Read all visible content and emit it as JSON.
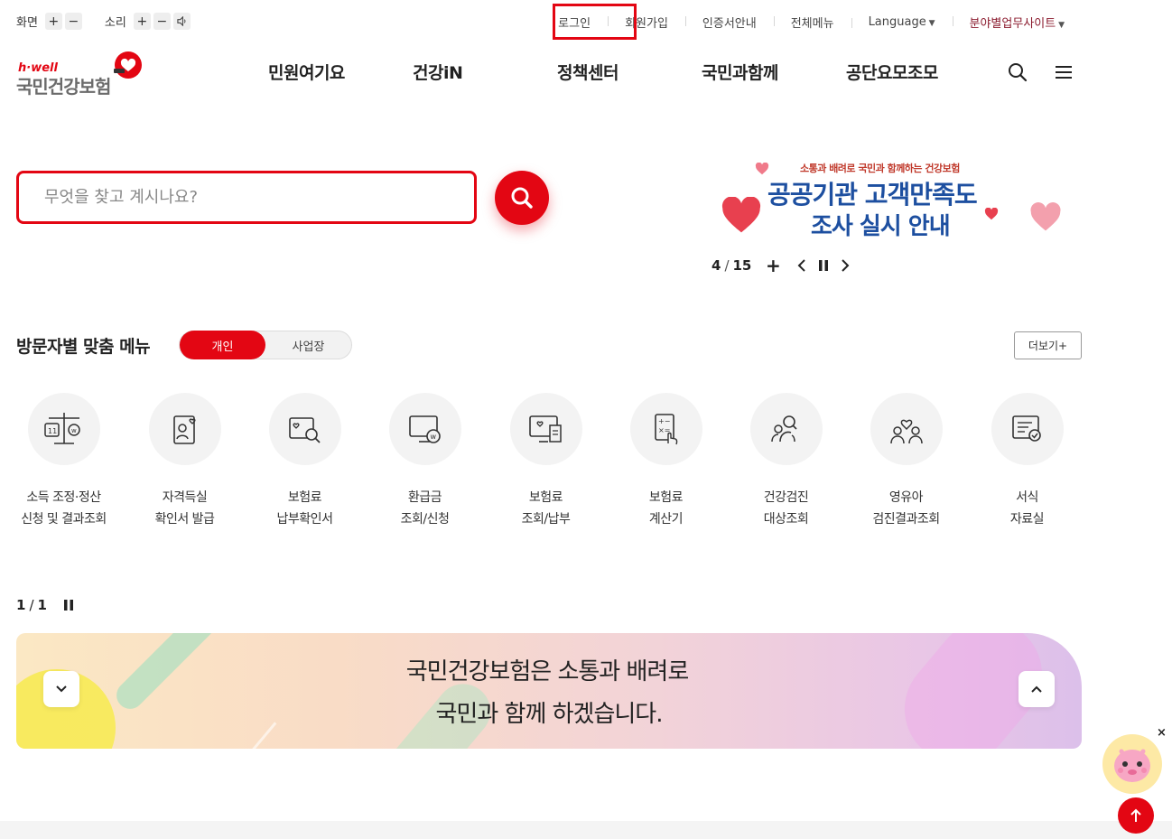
{
  "utility": {
    "screen_label": "화면",
    "sound_label": "소리",
    "plus": "+",
    "minus": "−",
    "links": {
      "login": "로그인",
      "signup": "회원가입",
      "cert": "인증서안내",
      "allmenu": "전체메뉴",
      "language": "Language",
      "biz": "분야별업무사이트"
    }
  },
  "logo": {
    "hwell": "h·well",
    "name": "국민건강보험"
  },
  "gnb": [
    "민원여기요",
    "건강iN",
    "정책센터",
    "국민과함께",
    "공단요모조모"
  ],
  "search": {
    "placeholder": "무엇을 찾고 계시나요?"
  },
  "banner": {
    "subtitle": "소통과 배려로 국민과 함께하는 건강보험",
    "title_line1": "공공기관 고객만족도",
    "title_line2": "조사 실시 안내",
    "current": "4",
    "separator": "/",
    "total": "15",
    "add": "+"
  },
  "visitor_menu": {
    "title": "방문자별 맞춤 메뉴",
    "tab_personal": "개인",
    "tab_business": "사업장",
    "more": "더보기+",
    "items": [
      {
        "line1": "소득 조정·정산",
        "line2": "신청 및 결과조회",
        "icon": "scale-icon"
      },
      {
        "line1": "자격득실",
        "line2": "확인서 발급",
        "icon": "id-card-icon"
      },
      {
        "line1": "보험료",
        "line2": "납부확인서",
        "icon": "document-search-icon"
      },
      {
        "line1": "환급금",
        "line2": "조회/신청",
        "icon": "monitor-won-icon"
      },
      {
        "line1": "보험료",
        "line2": "조회/납부",
        "icon": "monitor-receipt-icon"
      },
      {
        "line1": "보험료",
        "line2": "계산기",
        "icon": "calculator-icon"
      },
      {
        "line1": "건강검진",
        "line2": "대상조회",
        "icon": "people-search-icon"
      },
      {
        "line1": "영유아",
        "line2": "검진결과조회",
        "icon": "family-icon"
      },
      {
        "line1": "서식",
        "line2": "자료실",
        "icon": "form-document-icon"
      }
    ]
  },
  "slogan": {
    "current": "1",
    "separator": "/",
    "total": "1",
    "line1": "국민건강보험은 소통과 배려로",
    "line2": "국민과 함께 하겠습니다."
  },
  "floating": {
    "close": "×"
  },
  "colors": {
    "brand_red": "#e30613",
    "logo_gray": "#6b6b6b",
    "banner_blue": "#1d4fa0"
  }
}
